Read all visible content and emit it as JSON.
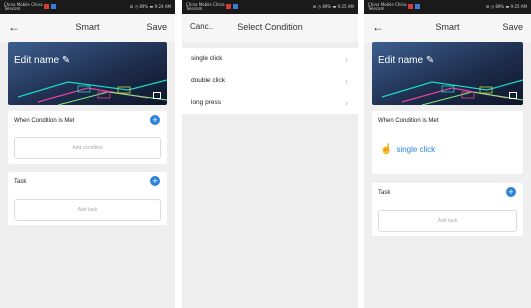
{
  "status_bar": {
    "carrier": "China Mobile China Telecom",
    "right_a": "☒ ◷ 89% ▬ 9:24 AM",
    "right_b": "☒ ◷ 89% ▬ 9:25 AM",
    "right_c": "☒ ◷ 89% ▬ 9:25 AM"
  },
  "screen1": {
    "title": "Smart",
    "save": "Save",
    "edit_name": "Edit name",
    "condition_label": "When Condition is Met",
    "add_condition": "Add condition",
    "task_label": "Task",
    "add_task": "Add task"
  },
  "screen2": {
    "cancel": "Canc..",
    "title": "Select Condition",
    "options": [
      "single click",
      "double click",
      "long press"
    ]
  },
  "screen3": {
    "title": "Smart",
    "save": "Save",
    "edit_name": "Edit name",
    "condition_label": "When Condition is Met",
    "selected_condition": "single click",
    "task_label": "Task",
    "add_task": "Add task"
  },
  "icons": {
    "back": "back-arrow-icon",
    "edit": "pencil-icon",
    "image": "image-icon",
    "add": "plus-icon",
    "chevron": "chevron-right-icon",
    "touch": "touch-icon"
  },
  "colors": {
    "accent": "#2d84d6",
    "background": "#efefef"
  }
}
